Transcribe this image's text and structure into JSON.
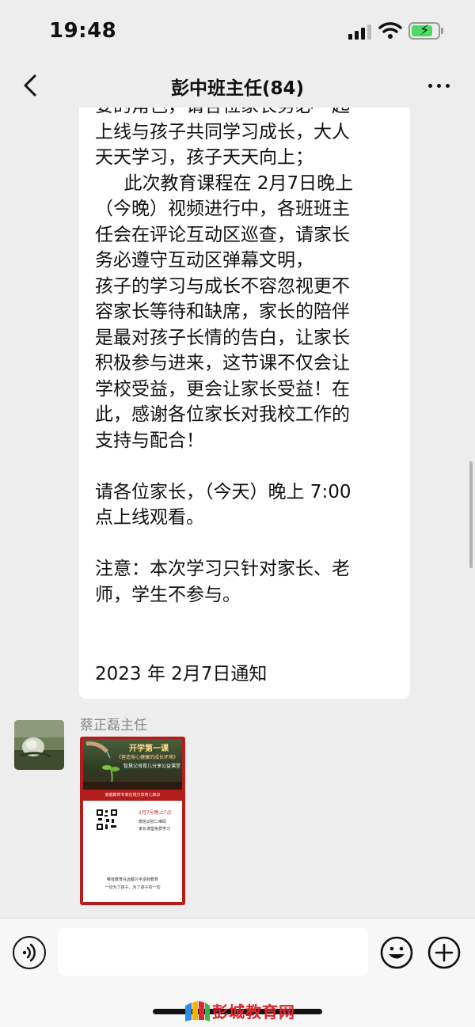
{
  "status_bar": {
    "time": "19:48"
  },
  "header": {
    "title": "彭中班主任(84)"
  },
  "message": {
    "lines": [
      "要的角色，请各位家长务必一起",
      "上线与孩子共同学习成长，大人",
      "天天学习，孩子天天向上；",
      "     此次教育课程在 2月7日晚上",
      "（今晚）视频进行中，各班班主",
      "任会在评论互动区巡查，请家长",
      "务必遵守互动区弹幕文明，",
      "孩子的学习与成长不容忽视更不",
      "容家长等待和缺席，家长的陪伴",
      "是最对孩子长情的告白，让家长",
      "积极参与进来，这节课不仅会让",
      "学校受益，更会让家长受益！在",
      "此，感谢各位家长对我校工作的",
      "支持与配合！",
      "",
      "请各位家长，（今天）晚上 7:00",
      "点上线观看。",
      "",
      "注意：本次学习只针对家长、老",
      "师，学生不参与。"
    ],
    "date_line": "2023 年 2月7日通知"
  },
  "second_message": {
    "sender": "蔡正磊主任",
    "poster": {
      "title": "开学第一课",
      "subtitle": "《营造身心健康的成长环境》",
      "subtitle2": "智慧父母育儿分享公益课堂",
      "band": "家庭教育专家在线分享育儿知识",
      "time": "2月7号晚上7点",
      "scan": "微信识别二维码",
      "free": "家长课堂免费学习",
      "footer1": "唯有教育在远都只手逆转教育",
      "footer2": "一切为了孩子，为了孩子的一切"
    }
  },
  "watermark": {
    "text": "彭城教育网"
  },
  "colors": {
    "background": "#ededed",
    "bubble": "#ffffff",
    "poster_red": "#b51d1d",
    "watermark_red": "#e0262f",
    "battery_green": "#4cd964"
  }
}
